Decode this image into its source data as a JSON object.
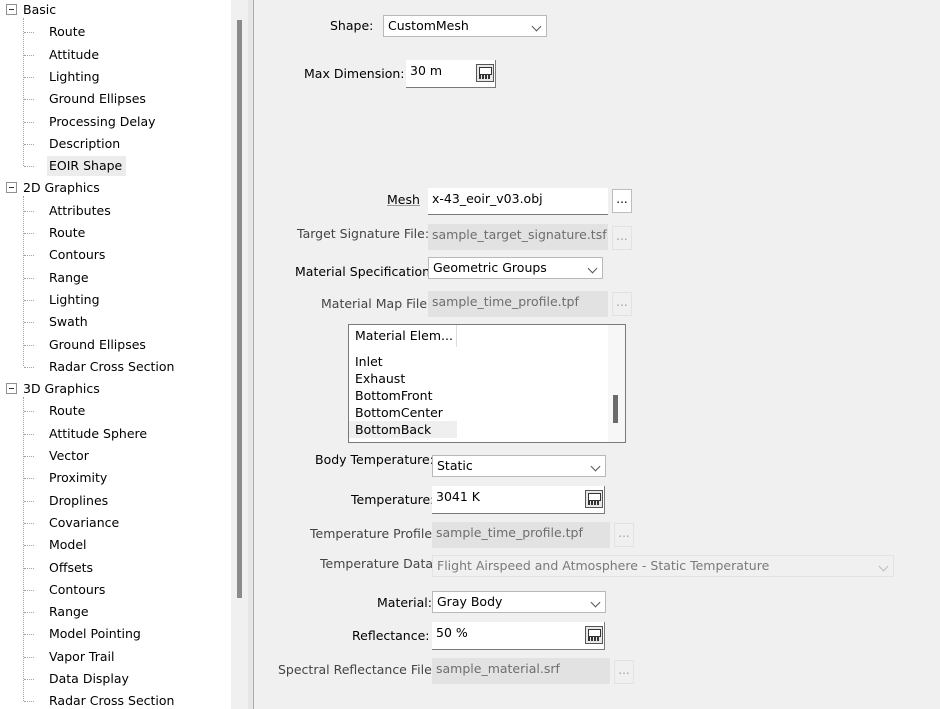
{
  "tree": {
    "groups": [
      {
        "label": "Basic",
        "children": [
          "Route",
          "Attitude",
          "Lighting",
          "Ground Ellipses",
          "Processing Delay",
          "Description",
          "EOIR Shape"
        ]
      },
      {
        "label": "2D Graphics",
        "children": [
          "Attributes",
          "Route",
          "Contours",
          "Range",
          "Lighting",
          "Swath",
          "Ground Ellipses",
          "Radar Cross Section"
        ]
      },
      {
        "label": "3D Graphics",
        "children": [
          "Route",
          "Attitude Sphere",
          "Vector",
          "Proximity",
          "Droplines",
          "Covariance",
          "Model",
          "Offsets",
          "Contours",
          "Range",
          "Model Pointing",
          "Vapor Trail",
          "Data Display",
          "Radar Cross Section"
        ]
      }
    ],
    "selected": "EOIR Shape"
  },
  "form": {
    "shape": {
      "label": "Shape:",
      "value": "CustomMesh"
    },
    "max_dimension": {
      "label": "Max Dimension:",
      "value": "30 m"
    },
    "mesh": {
      "label": "Mesh",
      "value": "x-43_eoir_v03.obj",
      "browse": "..."
    },
    "target_signature": {
      "label": "Target Signature File:",
      "value": "sample_target_signature.tsf",
      "browse": "..."
    },
    "material_specification": {
      "label": "Material Specification:",
      "value": "Geometric Groups"
    },
    "material_map": {
      "label": "Material Map File:",
      "value": "sample_time_profile.tpf",
      "browse": "..."
    },
    "material_elements": {
      "header": "Material Elem...",
      "items": [
        "Inlet",
        "Exhaust",
        "BottomFront",
        "BottomCenter",
        "BottomBack"
      ],
      "highlighted": "BottomBack"
    },
    "body_temperature": {
      "label": "Body Temperature:",
      "value": "Static"
    },
    "temperature": {
      "label": "Temperature:",
      "value": "3041 K"
    },
    "temperature_profile": {
      "label": "Temperature Profile:",
      "value": "sample_time_profile.tpf",
      "browse": "..."
    },
    "temperature_data": {
      "label": "Temperature Data:",
      "value": "Flight Airspeed and Atmosphere - Static Temperature"
    },
    "material": {
      "label": "Material:",
      "value": "Gray Body"
    },
    "reflectance": {
      "label": "Reflectance:",
      "value": "50 %"
    },
    "spectral_reflectance": {
      "label": "Spectral Reflectance File:",
      "value": "sample_material.srf",
      "browse": "..."
    }
  }
}
